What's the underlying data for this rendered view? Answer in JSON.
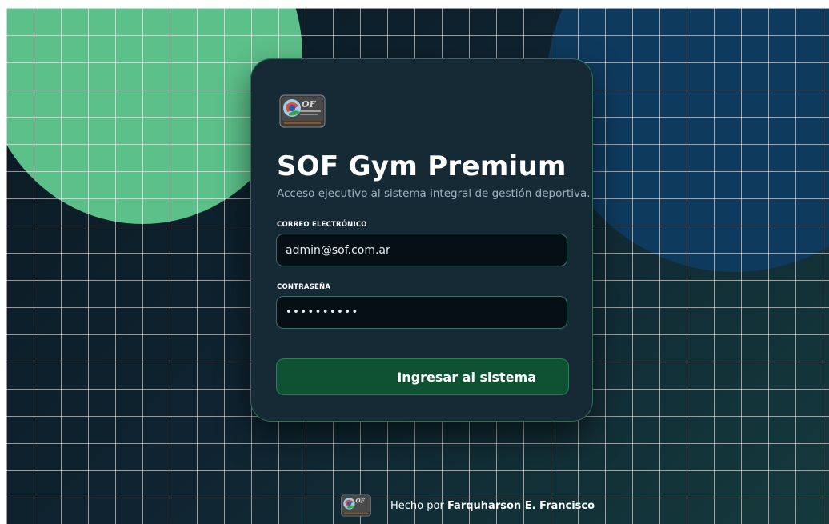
{
  "app": {
    "title": "SOF Gym Premium",
    "subtitle": "Acceso ejecutivo al sistema integral de gestión deportiva.",
    "logo_icon": "sof-logo-icon"
  },
  "form": {
    "email_label": "CORREO ELECTRÓNICO",
    "email_value": "admin@sof.com.ar",
    "password_label": "CONTRASEÑA",
    "password_value": "••••••••••",
    "submit_label": "Ingresar al sistema"
  },
  "footer": {
    "prefix": "Hecho por",
    "author": "Farquharson E. Francisco",
    "logo_icon": "sof-logo-icon"
  },
  "colors": {
    "accent_green": "#5cc08a",
    "accent_blue": "#0e3a5d",
    "card_bg": "#162a36",
    "button_bg": "#0f5233"
  }
}
